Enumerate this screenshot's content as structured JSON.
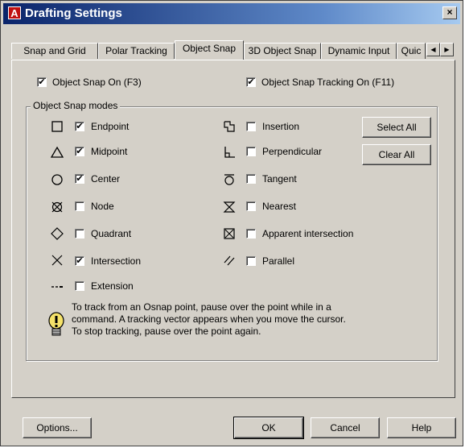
{
  "window": {
    "title": "Drafting Settings",
    "close_label": "×"
  },
  "tabs": [
    {
      "label": "Snap and Grid"
    },
    {
      "label": "Polar Tracking"
    },
    {
      "label": "Object Snap"
    },
    {
      "label": "3D Object Snap"
    },
    {
      "label": "Dynamic Input"
    },
    {
      "label": "Quic"
    }
  ],
  "tab_scroll": {
    "left": "◀",
    "right": "▶"
  },
  "options": {
    "osnap_on": {
      "label": "Object Snap On (F3)",
      "checked": true
    },
    "osnap_tracking": {
      "label": "Object Snap Tracking On (F11)",
      "checked": true
    }
  },
  "modes_group": {
    "title": "Object Snap modes"
  },
  "modes_left": [
    {
      "label": "Endpoint",
      "checked": true,
      "icon": "endpoint-icon"
    },
    {
      "label": "Midpoint",
      "checked": true,
      "icon": "midpoint-icon"
    },
    {
      "label": "Center",
      "checked": true,
      "icon": "center-icon"
    },
    {
      "label": "Node",
      "checked": false,
      "icon": "node-icon"
    },
    {
      "label": "Quadrant",
      "checked": false,
      "icon": "quadrant-icon"
    },
    {
      "label": "Intersection",
      "checked": true,
      "icon": "intersection-icon"
    },
    {
      "label": "Extension",
      "checked": false,
      "icon": "extension-icon"
    }
  ],
  "modes_right": [
    {
      "label": "Insertion",
      "checked": false,
      "icon": "insertion-icon"
    },
    {
      "label": "Perpendicular",
      "checked": false,
      "icon": "perpendicular-icon"
    },
    {
      "label": "Tangent",
      "checked": false,
      "icon": "tangent-icon"
    },
    {
      "label": "Nearest",
      "checked": false,
      "icon": "nearest-icon"
    },
    {
      "label": "Apparent intersection",
      "checked": false,
      "icon": "apparent-intersection-icon"
    },
    {
      "label": "Parallel",
      "checked": false,
      "icon": "parallel-icon"
    }
  ],
  "buttons": {
    "select_all": "Select All",
    "clear_all": "Clear All",
    "options": "Options...",
    "ok": "OK",
    "cancel": "Cancel",
    "help": "Help"
  },
  "tip": {
    "line1": "To track from an Osnap point, pause over the point while in a",
    "line2": "command.  A tracking vector appears when you move the cursor.",
    "line3": "To stop tracking, pause over the point again."
  },
  "colors": {
    "title_gradient_start": "#0a246a",
    "dialog_face": "#d4d0c8",
    "app_icon": "#c01010"
  }
}
